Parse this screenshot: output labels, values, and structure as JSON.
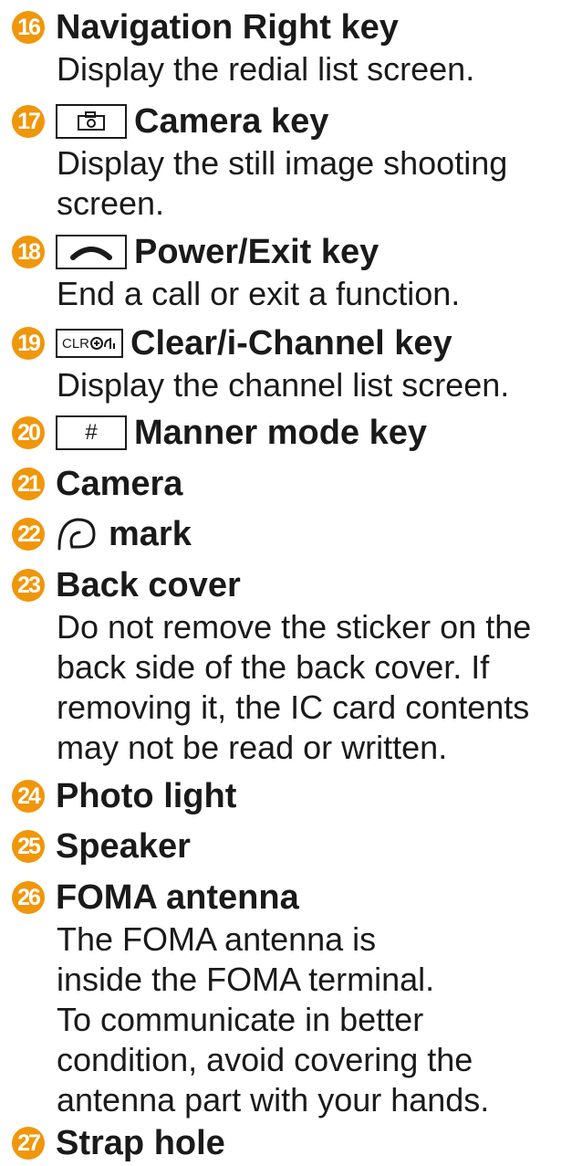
{
  "entries": [
    {
      "num": "16",
      "title": "Navigation Right key",
      "lines": [
        "Display the redial list screen."
      ]
    },
    {
      "num": "17",
      "title": "Camera key",
      "lines": [
        "Display the still image shooting",
        "screen."
      ]
    },
    {
      "num": "18",
      "title": "Power/Exit key",
      "lines": [
        "End a call or exit a function."
      ]
    },
    {
      "num": "19",
      "title": "Clear/i-Channel key",
      "key_label": "CLR",
      "lines": [
        "Display the channel list screen."
      ]
    },
    {
      "num": "20",
      "title": "Manner mode key",
      "key_label": "#",
      "lines": []
    },
    {
      "num": "21",
      "title": "Camera",
      "lines": []
    },
    {
      "num": "22",
      "title": "mark",
      "lines": []
    },
    {
      "num": "23",
      "title": "Back cover",
      "lines": [
        "Do not remove the sticker on the",
        "back side of the back cover. If",
        "removing it, the IC card contents",
        "may not be read or written."
      ]
    },
    {
      "num": "24",
      "title": "Photo light",
      "lines": []
    },
    {
      "num": "25",
      "title": "Speaker",
      "lines": []
    },
    {
      "num": "26",
      "title": "FOMA antenna",
      "lines": [
        "The FOMA antenna is",
        "inside the FOMA terminal.",
        "To communicate in better",
        "condition, avoid covering the",
        "antenna part with your hands."
      ]
    },
    {
      "num": "27",
      "title": "Strap hole",
      "lines": []
    }
  ],
  "colors": {
    "badge": "#f0960a",
    "text": "#1a1a1a"
  },
  "icons": {
    "camera_key": "camera-icon",
    "power_key": "power-arc-icon",
    "clear_key": "clr-ichannel-icon",
    "felica_mark": "felica-mark-icon"
  }
}
